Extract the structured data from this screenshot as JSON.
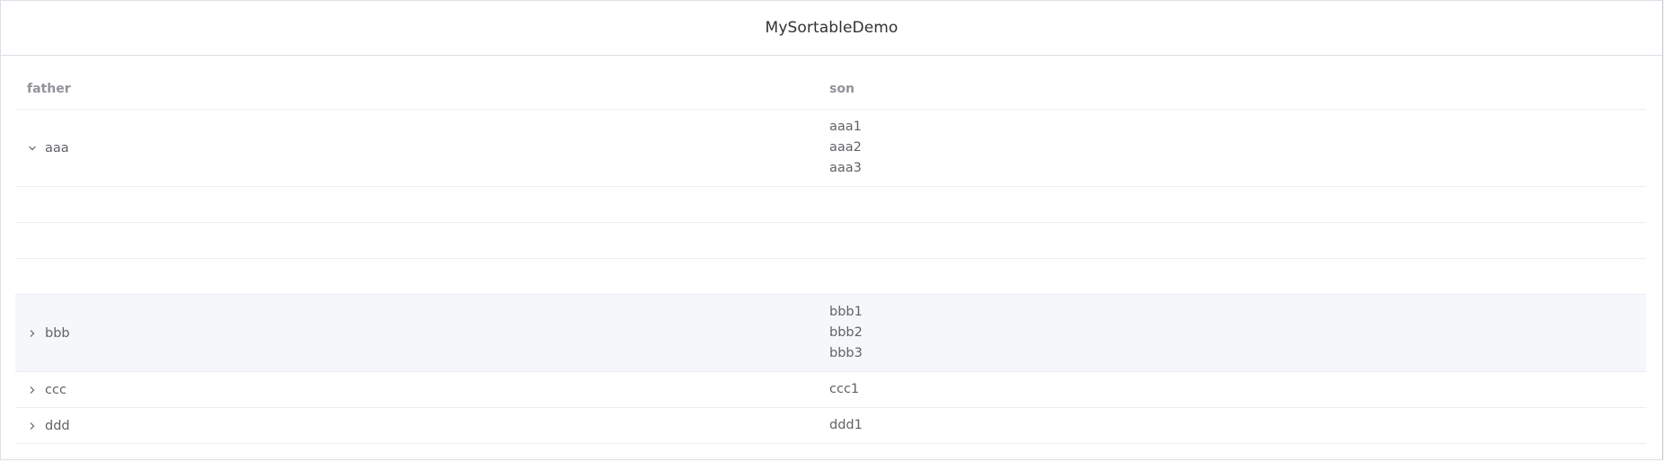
{
  "header": {
    "title": "MySortableDemo"
  },
  "table": {
    "columns": {
      "father": "father",
      "son": "son"
    },
    "rows": [
      {
        "father": "aaa",
        "expanded": true,
        "sons": [
          "aaa1",
          "aaa2",
          "aaa3"
        ]
      },
      {
        "father": "bbb",
        "expanded": false,
        "sons": [
          "bbb1",
          "bbb2",
          "bbb3"
        ]
      },
      {
        "father": "ccc",
        "expanded": false,
        "sons": [
          "ccc1"
        ]
      },
      {
        "father": "ddd",
        "expanded": false,
        "sons": [
          "ddd1"
        ]
      }
    ]
  },
  "colors": {
    "border": "#ebeef5",
    "header_text": "#909399",
    "cell_text": "#606266",
    "hover_row": "#f5f7fa"
  }
}
